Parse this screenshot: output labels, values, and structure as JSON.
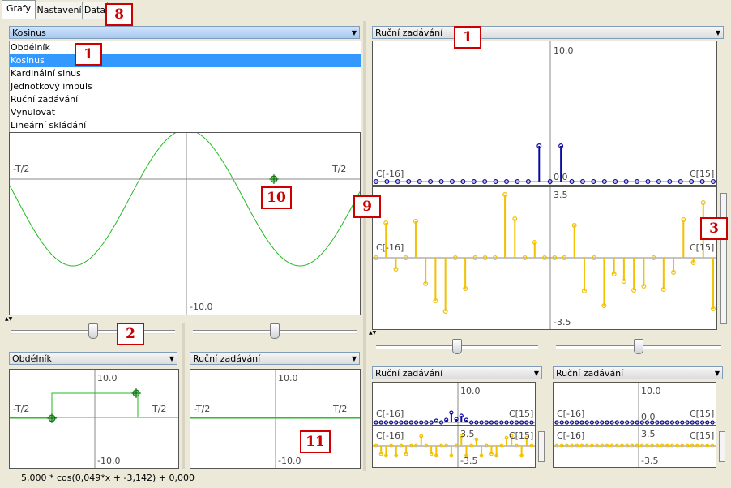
{
  "tabs": [
    "Grafy",
    "Nastavení",
    "Data"
  ],
  "function_options": [
    "Obdélník",
    "Kosinus",
    "Kardinální sinus",
    "Jednotkový impuls",
    "Ruční zadávání",
    "Vynulovat",
    "Lineární skládání"
  ],
  "main_left": {
    "combo_value": "Kosinus",
    "selected_option": "Kosinus",
    "label_left": "-T/2",
    "label_right": "T/2",
    "label_bottom": "-10.0"
  },
  "main_right": {
    "combo_value": "Ruční zadávání",
    "top": {
      "label_top": "10.0",
      "label_mid": "0.0",
      "label_left": "C[-16]",
      "label_right": "C[15]"
    },
    "bottom": {
      "label_top": "3.5",
      "label_bottom": "-3.5",
      "label_left": "C[-16]",
      "label_right": "C[15]"
    }
  },
  "small_left_1": {
    "combo_value": "Obdélník",
    "label_top": "10.0",
    "label_left": "-T/2",
    "label_right": "T/2",
    "label_bottom": "-10.0"
  },
  "small_left_2": {
    "combo_value": "Ruční zadávání",
    "label_top": "10.0",
    "label_left": "-T/2",
    "label_right": "T/2",
    "label_bottom": "-10.0"
  },
  "small_right_1": {
    "combo_value": "Ruční zadávání",
    "label_top": "10.0",
    "label_left": "C[-16]",
    "label_right": "C[15]",
    "label_mid": "3.5",
    "label_left2": "C[-16]",
    "label_right2": "C[15]",
    "label_bottom": "-3.5"
  },
  "small_right_2": {
    "combo_value": "Ruční zadávání",
    "label_top": "10.0",
    "label_left": "C[-16]",
    "label_right": "C[15]",
    "label_zero": "0.0",
    "label_mid": "3.5",
    "label_left2": "C[-16]",
    "label_right2": "C[15]",
    "label_bottom": "-3.5"
  },
  "status_text": "5,000 * cos(0,049*x + -3,142) + 0,000",
  "badges": [
    "1",
    "1",
    "2",
    "3",
    "8",
    "9",
    "10",
    "11"
  ],
  "colors": {
    "signal_green": "#22bb22",
    "magnitude_blue": "#0a0aa0",
    "phase_yellow": "#f2c100",
    "selection": "#3399ff",
    "badge_red": "#cc0000"
  },
  "icons": [
    "dropdown-arrow-icon",
    "drag-point-icon",
    "slider-thumb-icon"
  ]
}
